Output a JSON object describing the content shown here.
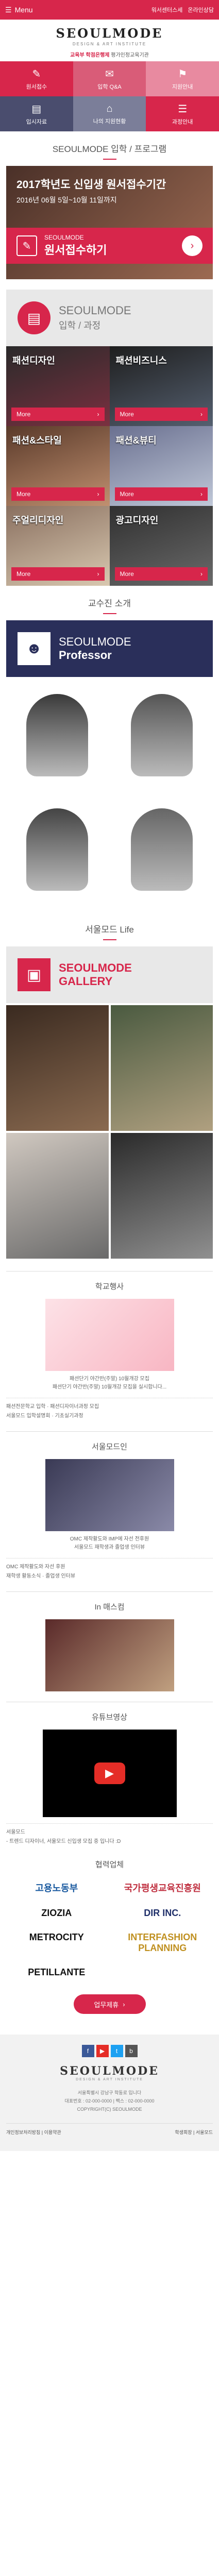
{
  "topbar": {
    "menu_label": "Menu",
    "link1": "워서센터스세",
    "link2": "온라인상담"
  },
  "brand": {
    "logo": "SEOULMODE",
    "sub": "DESIGN & ART INSTITUTE",
    "cert_bold": "교육부 학점은행제",
    "cert_rest": "평가인정교육기관"
  },
  "quick": [
    {
      "label": "원서접수",
      "icon": "✎",
      "color": "#d7264b"
    },
    {
      "label": "입학 Q&A",
      "icon": "✉",
      "color": "#d95c78"
    },
    {
      "label": "지원안내",
      "icon": "⚑",
      "color": "#e88aa0"
    },
    {
      "label": "입시자료",
      "icon": "▤",
      "color": "#4a4d6e"
    },
    {
      "label": "나의 지원현황",
      "icon": "⌂",
      "color": "#7b7e99"
    },
    {
      "label": "과정안내",
      "icon": "☰",
      "color": "#d7264b"
    }
  ],
  "admission": {
    "title": "SEOULMODE 입학 / 프로그램",
    "promo_l1": "2017학년도 신입생 원서접수기간",
    "promo_l2": "2016년 06월 5일~10월 11일까지",
    "bar_l1": "SEOULMODE",
    "bar_l2": "원서접수하기"
  },
  "course_head": {
    "t1": "SEOULMODE",
    "t2": "입학 / 과정"
  },
  "courses": [
    {
      "title": "패션디자인",
      "more": "More",
      "bg": "linear-gradient(160deg,#2a2a2a,#7a3040)"
    },
    {
      "title": "패션비즈니스",
      "more": "More",
      "bg": "linear-gradient(160deg,#1e1e1e,#556070)"
    },
    {
      "title": "패션&스타일",
      "more": "More",
      "bg": "linear-gradient(160deg,#5a3a2a,#c09070)"
    },
    {
      "title": "패션&뷰티",
      "more": "More",
      "bg": "linear-gradient(160deg,#6a7090,#c0c8d8)"
    },
    {
      "title": "주얼리디자인",
      "more": "More",
      "bg": "linear-gradient(160deg,#8a7060,#d8c8b0)"
    },
    {
      "title": "광고디자인",
      "more": "More",
      "bg": "linear-gradient(160deg,#303030,#6a6a6a)"
    }
  ],
  "professor": {
    "section_title": "교수진 소개",
    "t1": "SEOULMODE",
    "t2": "Professor"
  },
  "profs": [
    {
      "color": "#3a3a3a"
    },
    {
      "color": "#555555"
    },
    {
      "color": "#444444"
    },
    {
      "color": "#666666"
    }
  ],
  "gallery": {
    "section_title": "서울모드 Life",
    "t1": "SEOULMODE",
    "t2": "GALLERY"
  },
  "gals": [
    {
      "bg": "linear-gradient(160deg,#3a2a20,#8a6a50)"
    },
    {
      "bg": "linear-gradient(160deg,#4a5a40,#b0a080)"
    },
    {
      "bg": "linear-gradient(160deg,#d0c8c0,#6a6a6a)"
    },
    {
      "bg": "linear-gradient(160deg,#2a2a2a,#909090)"
    }
  ],
  "news": [
    {
      "title": "학교행사",
      "cap1": "패션단기 야간반(주말) 10월개강 모집",
      "cap2": "패션단기 야간반(주말) 10월개강 모집을 실시합니다...",
      "line1": "패션전문학교 입학 · 패션디자이너과정 모집",
      "line2": "서울모드 입학설명회 · 기초실기과정",
      "img": "linear-gradient(135deg,#fde2e7,#f8b6c3)"
    },
    {
      "title": "서울모드인",
      "cap1": "OMC 제작활도와 IMP에 자선 전후원",
      "cap2": "서울모드 재학생과 졸업생 인터뷰",
      "line1": "OMC 제작활도와 자선 후원",
      "line2": "재학생 활동소식 · 졸업생 인터뷰",
      "img": "linear-gradient(135deg,#3a3a55,#8a8aa8)"
    },
    {
      "title": "In 매스컴",
      "cap1": "",
      "cap2": "",
      "line1": "",
      "line2": "",
      "img": "linear-gradient(135deg,#5a2a2a,#c0a080)"
    }
  ],
  "video": {
    "title": "유튜브영상",
    "cap1": "서울모드",
    "cap2": "- 트렌드 디자이너, 서울모드 신입생 모집 중 입니다 :D"
  },
  "partners": {
    "title": "협력업체",
    "button": "업무제휴"
  },
  "partner_list": [
    {
      "name": "고용노동부",
      "color": "#1a5aa0"
    },
    {
      "name": "국가평생교육진흥원",
      "color": "#c03040"
    },
    {
      "name": "ZIOZIA",
      "color": "#111111"
    },
    {
      "name": "DIR INC.",
      "color": "#20306a"
    },
    {
      "name": "METROCITY",
      "color": "#111111"
    },
    {
      "name": "INTERFASHION PLANNING",
      "color": "#c09020"
    },
    {
      "name": "PETILLANTE",
      "color": "#111111"
    }
  ],
  "footer": {
    "logo": "SEOULMODE",
    "sub": "DESIGN & ART INSTITUTE",
    "addr1": "서울특별시 강남구 학동로 입니다",
    "addr2": "대표번호 : 02-000-0000 | 팩스 : 02-000-0000",
    "addr3": "COPYRIGHT(C) SEOULMODE",
    "left": "개인정보처리방침 | 이용약관",
    "right": "학생회장 | 서울모드"
  }
}
